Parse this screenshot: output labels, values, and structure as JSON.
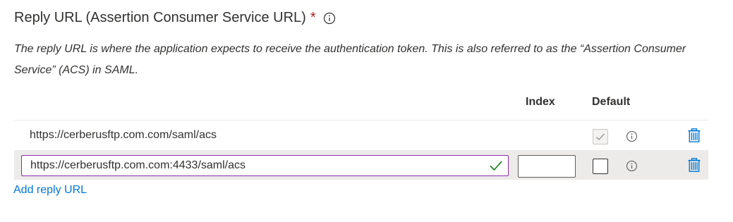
{
  "section": {
    "title": "Reply URL (Assertion Consumer Service URL)",
    "required_marker": "*",
    "info_icon": "info-icon",
    "description": "The reply URL is where the application expects to receive the authentication token. This is also referred to as the “Assertion Consumer Service” (ACS) in SAML."
  },
  "columns": {
    "index": "Index",
    "default": "Default"
  },
  "rows": [
    {
      "url": "https://cerberusftp.com.com/saml/acs",
      "index": "",
      "default_checked": true,
      "default_disabled": true,
      "editable": false
    },
    {
      "url": "https://cerberusftp.com.com:4433/saml/acs",
      "index": "",
      "default_checked": false,
      "default_disabled": false,
      "editable": true,
      "valid": true
    }
  ],
  "add_link": "Add reply URL",
  "colors": {
    "accent": "#0078d4",
    "required": "#a4262c",
    "focus_border": "#8a2da5",
    "valid_check": "#107c10",
    "selected_row_bg": "#edebe9"
  },
  "icons": {
    "info": "info-icon",
    "delete": "trash-icon",
    "valid": "checkmark-icon"
  }
}
